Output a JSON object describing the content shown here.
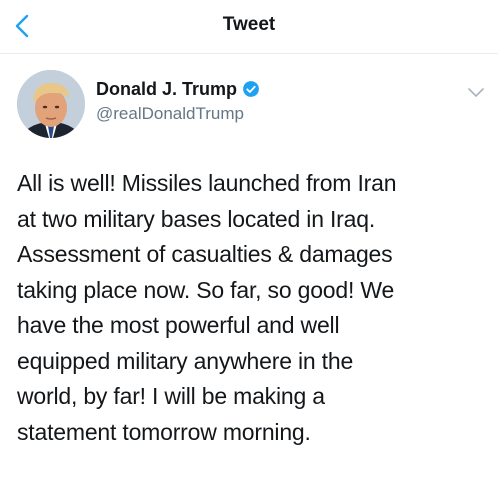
{
  "header": {
    "title": "Tweet",
    "back_icon": "chevron-left-icon",
    "accent_color": "#1da1f2"
  },
  "tweet": {
    "author": {
      "display_name": "Donald J. Trump",
      "handle": "@realDonaldTrump",
      "verified_icon": "verified-badge-icon",
      "avatar_icon": "profile-photo"
    },
    "menu_icon": "chevron-down-icon",
    "lines": [
      "All is well! Missiles launched from Iran",
      "at two military bases located in Iraq.",
      "Assessment of casualties & damages",
      "taking place now. So far, so good! We",
      "have the most powerful and well",
      "equipped military anywhere in the",
      "world, by far! I will be making a",
      "statement tomorrow morning."
    ]
  }
}
